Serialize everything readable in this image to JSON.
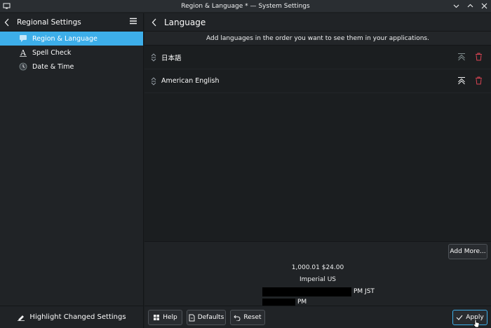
{
  "window": {
    "title": "Region & Language * — System Settings"
  },
  "sidebar": {
    "title": "Regional Settings",
    "items": [
      {
        "label": "Region & Language",
        "active": true,
        "icon": "region-icon"
      },
      {
        "label": "Spell Check",
        "active": false,
        "icon": "spell-check-icon"
      },
      {
        "label": "Date & Time",
        "active": false,
        "icon": "clock-icon"
      }
    ],
    "highlight_label": "Highlight Changed Settings"
  },
  "main": {
    "title": "Language",
    "info": "Add languages in the order you want to see them in your applications.",
    "languages": [
      {
        "name": "日本語"
      },
      {
        "name": "American English"
      }
    ],
    "add_more_label": "Add More...",
    "preview": {
      "numbers": "1,000.01  $24.00",
      "measurement": "Imperial US",
      "time_suffix_1": "PM JST",
      "time_suffix_2": "PM"
    }
  },
  "footer": {
    "help_label": "Help",
    "defaults_label": "Defaults",
    "reset_label": "Reset",
    "apply_label": "Apply"
  },
  "colors": {
    "accent": "#3daee9",
    "delete": "#da4453",
    "background": "#1b1e20"
  }
}
